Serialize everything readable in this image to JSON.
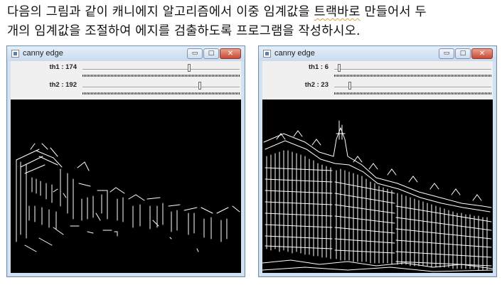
{
  "instruction": {
    "line1_before": "다음의 그림과 같이 캐니에지 알고리즘에서 이중 임계값을 ",
    "line1_flagged": "트랙바로",
    "line1_after": " 만들어서 두",
    "line2": "개의 임계값을 조절하여 에지를 검출하도록 프로그램을 작성하시오.",
    "spellcheck_color": "#d9a43a"
  },
  "windows": [
    {
      "title": "canny edge",
      "controls": {
        "minimize": "▭",
        "maximize": "□",
        "close": "✕"
      },
      "trackbars": [
        {
          "label": "th1 : 174",
          "value": 174,
          "max": 255
        },
        {
          "label": "th2 : 192",
          "value": 192,
          "max": 255
        }
      ],
      "edge_density": "sparse"
    },
    {
      "title": "canny edge",
      "controls": {
        "minimize": "▭",
        "maximize": "□",
        "close": "✕"
      },
      "trackbars": [
        {
          "label": "th1 : 6",
          "value": 6,
          "max": 255
        },
        {
          "label": "th2 : 23",
          "value": 23,
          "max": 255
        }
      ],
      "edge_density": "dense"
    }
  ],
  "colors": {
    "canvas_background": "#000000",
    "edge_lines": "#ffffff",
    "window_frame": "#d4e3f3",
    "close_button": "#c64a34"
  }
}
